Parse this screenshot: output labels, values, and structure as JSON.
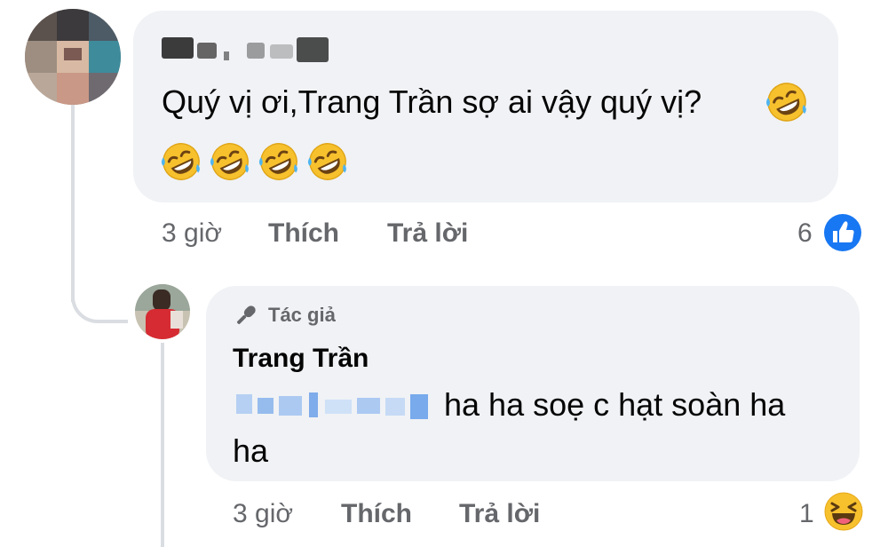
{
  "comment": {
    "body": "Quý vị ơi,Trang Trần sợ ai vậy quý vị?",
    "inline_emoji": "rolling-on-floor-laughing-icon",
    "emoji_row_count": 4,
    "time": "3 giờ",
    "like_label": "Thích",
    "reply_label": "Trả lời",
    "reaction_count": "6",
    "reaction_icon": "like-reaction-icon",
    "reaction_color": "#1877f2"
  },
  "reply": {
    "badge_label": "Tác giả",
    "author_name": "Trang Trần",
    "body_line1": "ha ha soẹ c hạt soàn ha",
    "body_line2": "ha",
    "time": "3 giờ",
    "like_label": "Thích",
    "reply_label": "Trả lời",
    "reaction_count": "1",
    "reaction_icon": "haha-reaction-icon"
  },
  "colors": {
    "bubble": "#f0f2f5",
    "meta_text": "#65676b",
    "mention": "#1877f2",
    "thread_line": "#dadde1"
  }
}
